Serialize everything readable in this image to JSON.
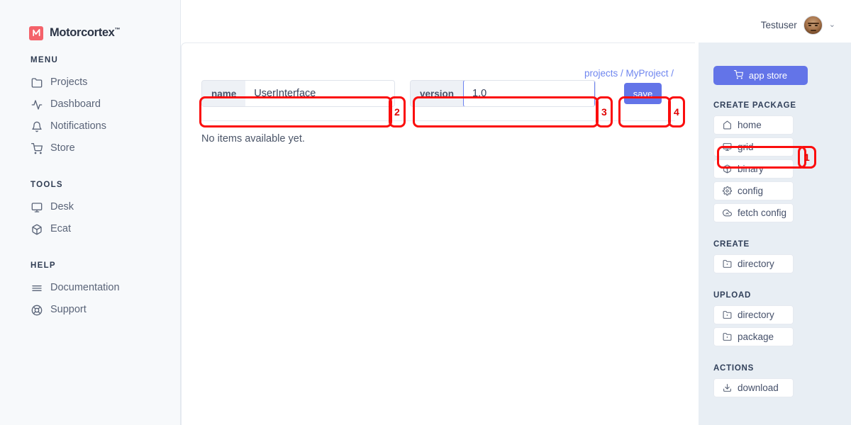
{
  "brand": {
    "name": "Motorcortex",
    "tm": "™",
    "logo_color": "#f4626a"
  },
  "topbar": {
    "username": "Testuser",
    "avatar_icon": "user-avatar",
    "chevron": "⌄"
  },
  "sidebar": {
    "sections": [
      {
        "heading": "MENU",
        "items": [
          {
            "label": "Projects",
            "icon": "folder-icon"
          },
          {
            "label": "Dashboard",
            "icon": "activity-icon"
          },
          {
            "label": "Notifications",
            "icon": "bell-icon"
          },
          {
            "label": "Store",
            "icon": "cart-icon"
          }
        ]
      },
      {
        "heading": "TOOLS",
        "items": [
          {
            "label": "Desk",
            "icon": "monitor-icon"
          },
          {
            "label": "Ecat",
            "icon": "cube-icon"
          }
        ]
      },
      {
        "heading": "HELP",
        "items": [
          {
            "label": "Documentation",
            "icon": "lines-icon"
          },
          {
            "label": "Support",
            "icon": "lifebuoy-icon"
          }
        ]
      }
    ]
  },
  "main": {
    "breadcrumb": "projects / MyProject /",
    "name_field": {
      "label": "name",
      "value": "UserInterface",
      "placeholder": ""
    },
    "version_field": {
      "label": "version",
      "value": "1.0",
      "placeholder": "",
      "focused": true
    },
    "save_label": "save",
    "empty_message": "No items available yet."
  },
  "right_sidebar": {
    "app_store_label": "app store",
    "app_store_icon": "cart-icon",
    "groups": [
      {
        "heading": "CREATE PACKAGE",
        "items": [
          {
            "label": "home",
            "icon": "home-icon"
          },
          {
            "label": "grid",
            "icon": "monitor-icon"
          },
          {
            "label": "binary",
            "icon": "cube-icon"
          },
          {
            "label": "config",
            "icon": "gear-icon"
          },
          {
            "label": "fetch config",
            "icon": "cloud-fetch-icon"
          }
        ]
      },
      {
        "heading": "CREATE",
        "items": [
          {
            "label": "directory",
            "icon": "folder-plus-icon"
          }
        ]
      },
      {
        "heading": "UPLOAD",
        "items": [
          {
            "label": "directory",
            "icon": "folder-plus-icon"
          },
          {
            "label": "package",
            "icon": "folder-plus-icon"
          }
        ]
      },
      {
        "heading": "ACTIONS",
        "items": [
          {
            "label": "download",
            "icon": "download-icon"
          }
        ]
      }
    ]
  },
  "annotations": [
    {
      "number": "1",
      "target": "grid-package-button"
    },
    {
      "number": "2",
      "target": "name-input-group"
    },
    {
      "number": "3",
      "target": "version-input-group"
    },
    {
      "number": "4",
      "target": "save-button"
    }
  ],
  "colors": {
    "accent": "#6374e8",
    "annotation": "#fb0d0d",
    "link": "#6f86ef"
  }
}
